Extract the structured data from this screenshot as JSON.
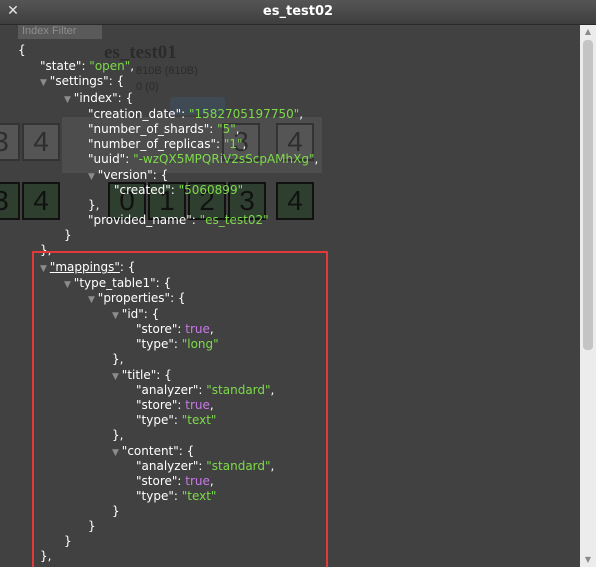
{
  "window": {
    "title": "es_test02"
  },
  "background": {
    "filter_label": "Index Filter",
    "index_name": "es_test01",
    "size": "810B (810B)",
    "count": "0 (0)",
    "shards_row1": [
      "3",
      "4",
      "3",
      "4"
    ],
    "shards_row2": [
      "3",
      "4",
      "0",
      "1",
      "2",
      "3",
      "4"
    ]
  },
  "json": {
    "open_brace": "{",
    "state_key": "\"state\"",
    "state_val": "\"open\"",
    "settings_key": "\"settings\"",
    "index_key": "\"index\"",
    "creation_date_key": "\"creation_date\"",
    "creation_date_val": "\"1582705197750\"",
    "number_of_shards_key": "\"number_of_shards\"",
    "number_of_shards_val": "\"5\"",
    "number_of_replicas_key": "\"number_of_replicas\"",
    "number_of_replicas_val": "\"1\"",
    "uuid_key": "\"uuid\"",
    "uuid_val": "\"-wzQX5MPQRiV2sScpAMhXg\"",
    "version_key": "\"version\"",
    "created_key": "\"created\"",
    "created_val": "\"5060899\"",
    "provided_name_key": "\"provided_name\"",
    "provided_name_val": "\"es_test02\"",
    "mappings_key": "\"mappings\"",
    "type_table1_key": "\"type_table1\"",
    "properties_key": "\"properties\"",
    "id_key": "\"id\"",
    "store_key": "\"store\"",
    "type_key": "\"type\"",
    "analyzer_key": "\"analyzer\"",
    "true_val": "true",
    "long_val": "\"long\"",
    "title_key": "\"title\"",
    "standard_val": "\"standard\"",
    "text_val": "\"text\"",
    "content_key": "\"content\""
  }
}
